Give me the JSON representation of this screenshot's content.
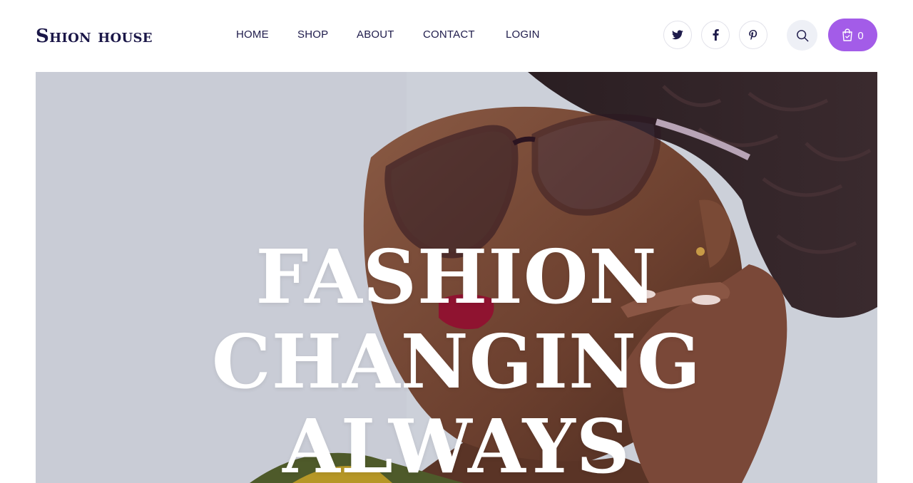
{
  "brand": {
    "logo_text": "Shion house"
  },
  "nav": {
    "items": [
      {
        "label": "HOME"
      },
      {
        "label": "SHOP"
      },
      {
        "label": "ABOUT"
      },
      {
        "label": "CONTACT"
      },
      {
        "label": "LOGIN"
      }
    ]
  },
  "social": [
    {
      "icon": "twitter-icon"
    },
    {
      "icon": "facebook-icon"
    },
    {
      "icon": "pinterest-icon"
    }
  ],
  "search": {
    "icon": "search-icon"
  },
  "cart": {
    "icon": "shopping-bag-icon",
    "count": "0",
    "accent": "#a35ce8"
  },
  "hero": {
    "title_lines": [
      "FASHION",
      "CHANGING",
      "ALWAYS"
    ],
    "image": "woman-with-glasses-photo"
  },
  "colors": {
    "text": "#1e1b4b",
    "accent": "#a35ce8",
    "hero_bg": "#cdd0d9"
  }
}
